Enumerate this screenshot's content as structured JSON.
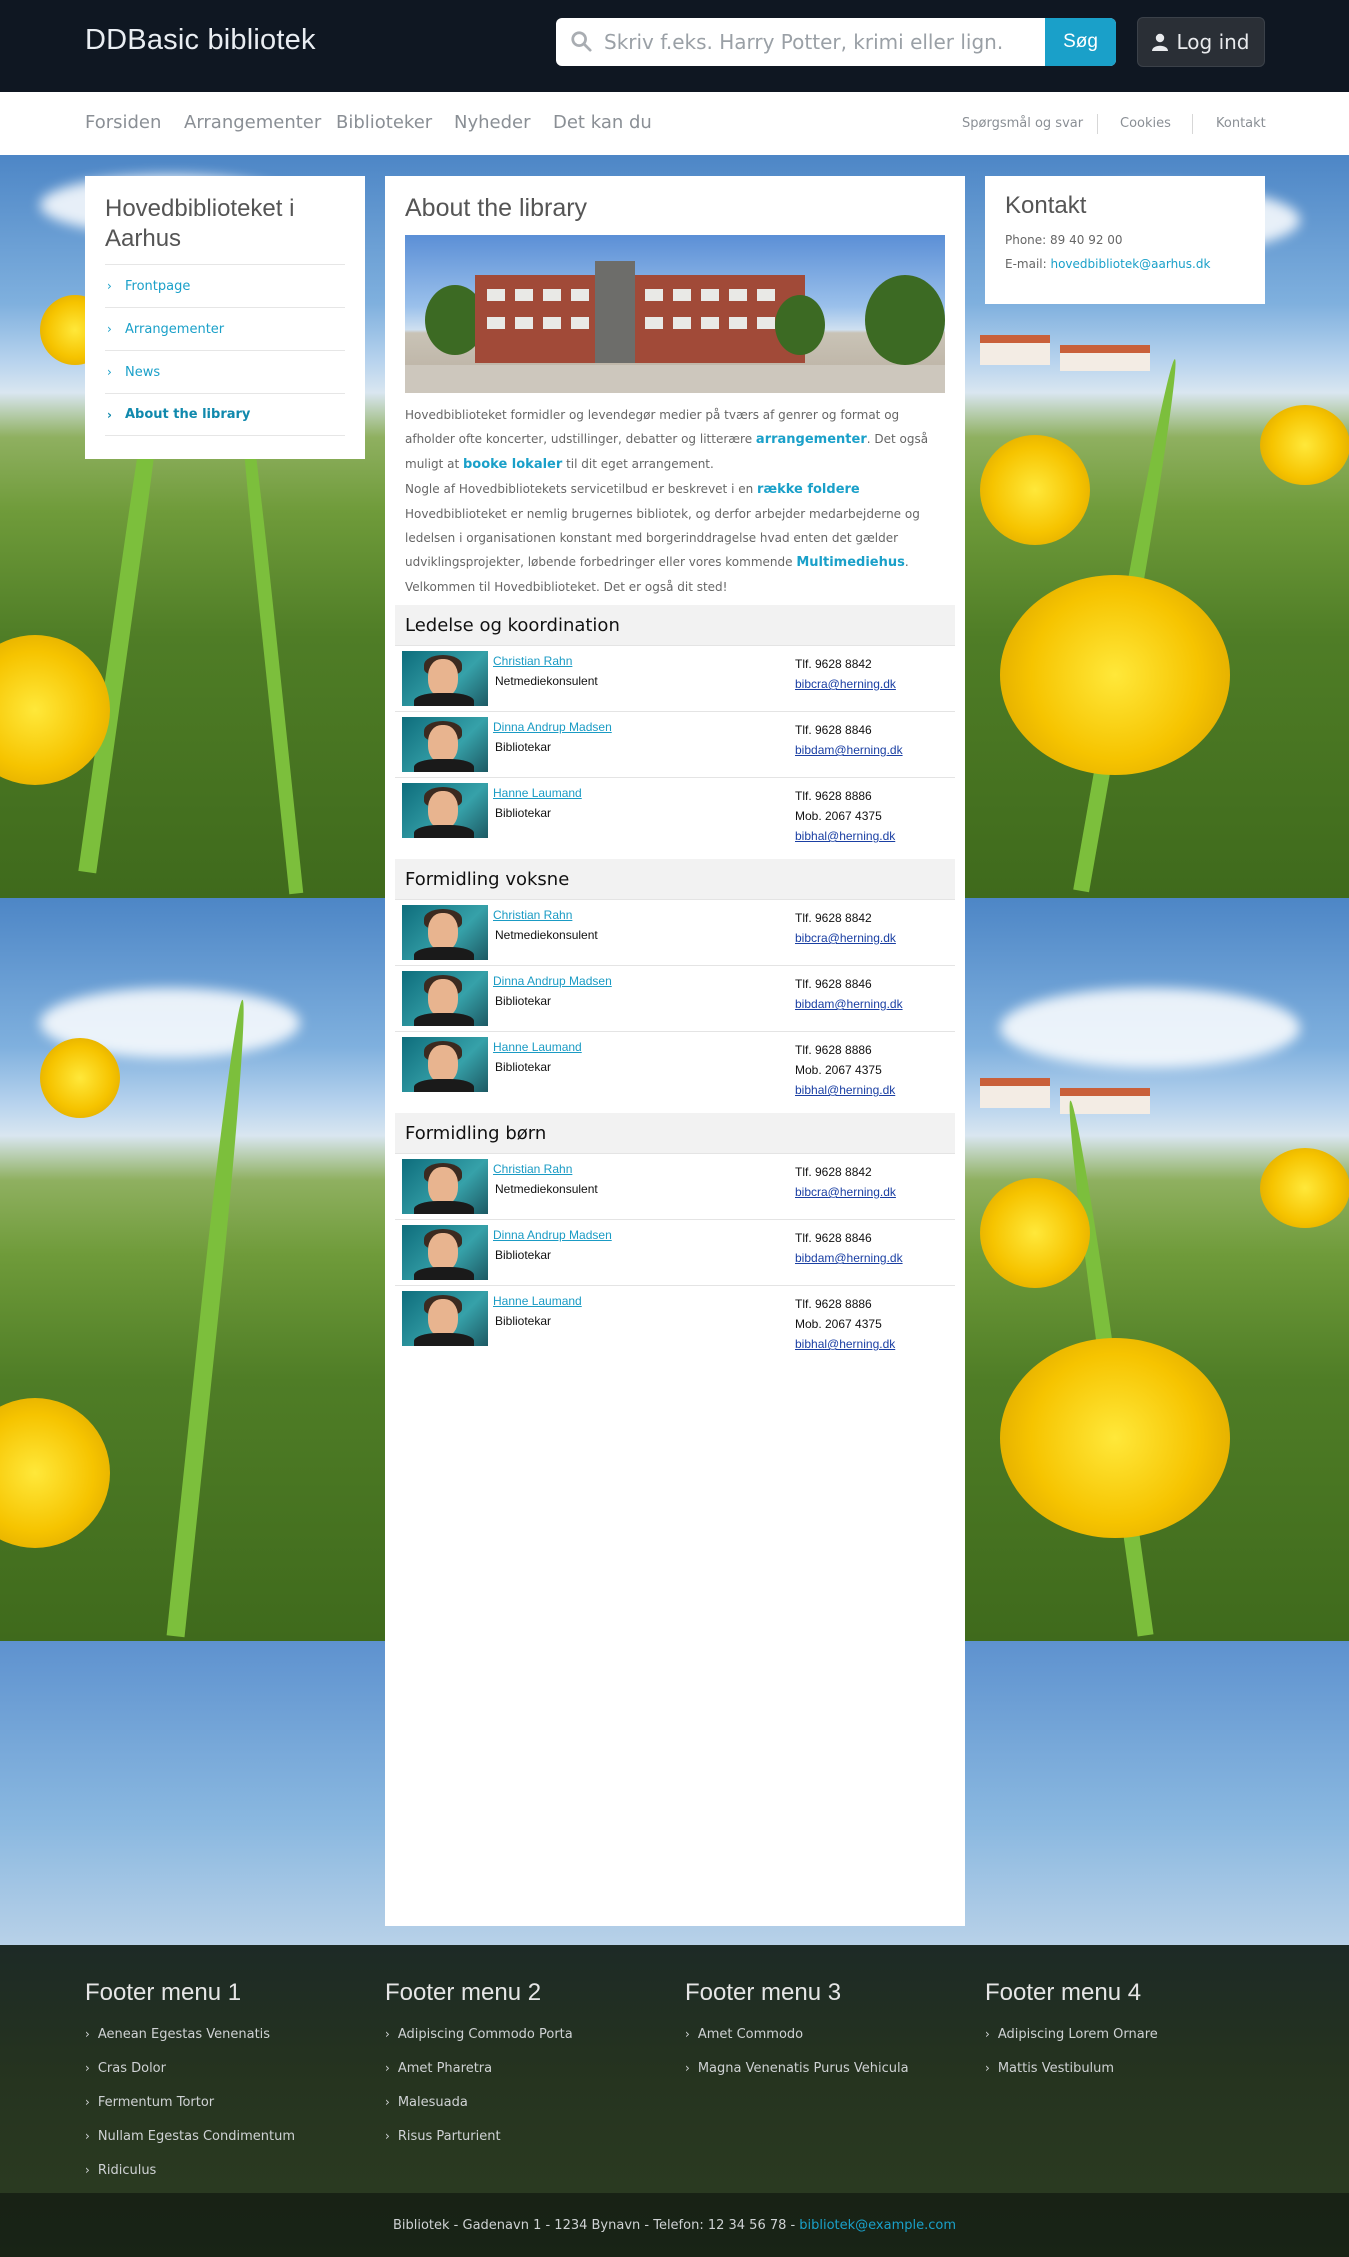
{
  "site": {
    "title": "DDBasic bibliotek"
  },
  "search": {
    "placeholder": "Skriv f.eks. Harry Potter, krimi eller lign.",
    "button_label": "Søg"
  },
  "login": {
    "label": "Log ind"
  },
  "main_nav": [
    "Forsiden",
    "Arrangementer",
    "Biblioteker",
    "Nyheder",
    "Det kan du"
  ],
  "secondary_nav": [
    "Spørgsmål og svar",
    "Cookies",
    "Kontakt"
  ],
  "sidebar": {
    "title": "Hovedbiblioteket i Aarhus",
    "items": [
      {
        "label": "Frontpage",
        "active": false
      },
      {
        "label": "Arrangementer",
        "active": false
      },
      {
        "label": "News",
        "active": false
      },
      {
        "label": "About the library",
        "active": true
      }
    ]
  },
  "content": {
    "title": "About the library",
    "intro": {
      "p1_a": "Hovedbiblioteket formidler og levendegør medier på tværs af genrer og format og afholder ofte koncerter, udstillinger, debatter og litterære ",
      "p1_link": "arrangementer",
      "p1_b": ". Det også muligt at ",
      "p1_link2": "booke lokaler",
      "p1_c": " til dit eget arrangement.",
      "p2_a": "Nogle af Hovedbibliotekets servicetilbud er beskrevet i en ",
      "p2_link": "række foldere",
      "p3_a": "Hovedbiblioteket er nemlig brugernes bibliotek, og derfor arbejder medarbejderne og ledelsen i organisationen konstant med borgerinddragelse hvad enten det gælder udviklingsprojekter, løbende forbedringer eller vores kommende ",
      "p3_link": "Multimediehus",
      "p3_b": ".",
      "p4": "Velkommen til Hovedbiblioteket. Det er også dit sted!"
    },
    "sections": [
      {
        "heading": "Ledelse og koordination",
        "staff": [
          {
            "name": "Christian Rahn",
            "role": "Netmediekonsulent",
            "phone": "Tlf.  9628 8842",
            "mobile": "",
            "email": "bibcra@herning.dk"
          },
          {
            "name": "Dinna Andrup Madsen",
            "role": "Bibliotekar",
            "phone": "Tlf.  9628 8846",
            "mobile": "",
            "email": "bibdam@herning.dk"
          },
          {
            "name": "Hanne Laumand",
            "role": "Bibliotekar",
            "phone": "Tlf.  9628 8886",
            "mobile": "Mob.  2067 4375",
            "email": "bibhal@herning.dk"
          }
        ]
      },
      {
        "heading": "Formidling voksne",
        "staff": [
          {
            "name": "Christian Rahn",
            "role": "Netmediekonsulent",
            "phone": "Tlf.  9628 8842",
            "mobile": "",
            "email": "bibcra@herning.dk"
          },
          {
            "name": "Dinna Andrup Madsen",
            "role": "Bibliotekar",
            "phone": "Tlf.  9628 8846",
            "mobile": "",
            "email": "bibdam@herning.dk"
          },
          {
            "name": "Hanne Laumand",
            "role": "Bibliotekar",
            "phone": "Tlf.  9628 8886",
            "mobile": "Mob.  2067 4375",
            "email": "bibhal@herning.dk"
          }
        ]
      },
      {
        "heading": "Formidling børn",
        "staff": [
          {
            "name": "Christian Rahn",
            "role": "Netmediekonsulent",
            "phone": "Tlf.  9628 8842",
            "mobile": "",
            "email": "bibcra@herning.dk"
          },
          {
            "name": "Dinna Andrup Madsen",
            "role": "Bibliotekar",
            "phone": "Tlf.  9628 8846",
            "mobile": "",
            "email": "bibdam@herning.dk"
          },
          {
            "name": "Hanne Laumand",
            "role": "Bibliotekar",
            "phone": "Tlf.  9628 8886",
            "mobile": "Mob.  2067 4375",
            "email": "bibhal@herning.dk"
          }
        ]
      }
    ]
  },
  "contact": {
    "title": "Kontakt",
    "phone": "Phone: 89 40 92 00",
    "email_label": "E-mail: ",
    "email": "hovedbibliotek@aarhus.dk"
  },
  "footer": {
    "menus": [
      {
        "title": "Footer menu 1",
        "items": [
          "Aenean Egestas Venenatis",
          "Cras Dolor",
          "Fermentum Tortor",
          "Nullam Egestas Condimentum",
          "Ridiculus"
        ]
      },
      {
        "title": "Footer menu 2",
        "items": [
          "Adipiscing Commodo Porta",
          "Amet Pharetra",
          "Malesuada",
          "Risus Parturient"
        ]
      },
      {
        "title": "Footer menu 3",
        "items": [
          "Amet Commodo",
          "Magna Venenatis Purus Vehicula"
        ]
      },
      {
        "title": "Footer menu 4",
        "items": [
          "Adipiscing Lorem Ornare",
          "Mattis Vestibulum"
        ]
      }
    ],
    "address": "Bibliotek - Gadenavn 1 - 1234 Bynavn - Telefon: 12 34 56 78 -",
    "email": "bibliotek@example.com"
  },
  "colors": {
    "accent": "#1aa0c9",
    "topbar": "#0f1722",
    "staff_link": "#1a9bc4",
    "mail_link": "#1a3fa3"
  },
  "icons": {
    "search": "search-icon",
    "user": "user-icon",
    "chevron": "chevron-right-icon"
  }
}
